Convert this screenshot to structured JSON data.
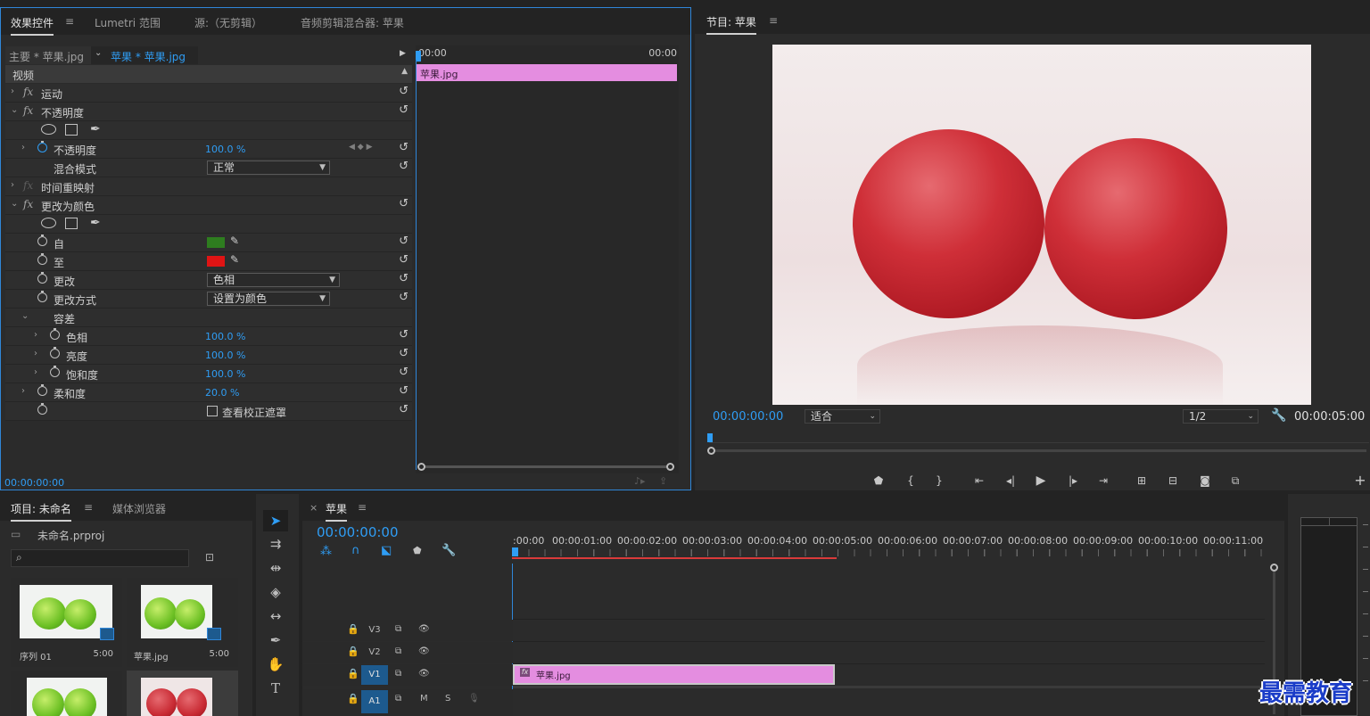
{
  "effects_panel": {
    "tabs": [
      "效果控件",
      "Lumetri 范围",
      "源:（无剪辑）",
      "音频剪辑混合器: 苹果"
    ],
    "menu_glyph": "≡",
    "master_clip": "主要 * 苹果.jpg",
    "sequence_clip": "苹果 * 苹果.jpg",
    "timeline_start": "00:00",
    "timeline_end": "00:00",
    "clip_name": "苹果.jpg",
    "section_video": "视频",
    "footer_time": "00:00:00:00",
    "effects": {
      "motion": "运动",
      "opacity": "不透明度",
      "opacity_param": "不透明度",
      "opacity_value": "100.0 %",
      "blend_mode_label": "混合模式",
      "blend_mode_value": "正常",
      "time_remap": "时间重映射",
      "change_to_color": "更改为颜色",
      "from_label": "自",
      "from_color": "#2e7d1f",
      "to_label": "至",
      "to_color": "#e01414",
      "change_label": "更改",
      "change_value": "色相",
      "change_by_label": "更改方式",
      "change_by_value": "设置为颜色",
      "tolerance_label": "容差",
      "hue_label": "色相",
      "hue_value": "100.0 %",
      "lightness_label": "亮度",
      "lightness_value": "100.0 %",
      "saturation_label": "饱和度",
      "saturation_value": "100.0 %",
      "softness_label": "柔和度",
      "softness_value": "20.0 %",
      "view_mask_label": "查看校正遮罩"
    }
  },
  "program_monitor": {
    "title": "节目: 苹果",
    "current_time": "00:00:00:00",
    "fit_value": "适合",
    "resolution_value": "1/2",
    "duration": "00:00:05:00",
    "bg_color": "#f0e4e5",
    "apple_color": "#c82a33"
  },
  "project_panel": {
    "tabs": [
      "项目: 未命名",
      "媒体浏览器"
    ],
    "project_file": "未命名.prproj",
    "search_placeholder": "",
    "items": [
      {
        "name": "序列 01",
        "duration": "5:00"
      },
      {
        "name": "苹果.jpg",
        "duration": "5:00"
      }
    ]
  },
  "timeline": {
    "close": "×",
    "sequence_name": "苹果",
    "current_time": "00:00:00:00",
    "ruler": [
      ":00:00",
      "00:00:01:00",
      "00:00:02:00",
      "00:00:03:00",
      "00:00:04:00",
      "00:00:05:00",
      "00:00:06:00",
      "00:00:07:00",
      "00:00:08:00",
      "00:00:09:00",
      "00:00:10:00",
      "00:00:11:00"
    ],
    "tracks": [
      "V3",
      "V2",
      "V1",
      "A1"
    ],
    "audio_m": "M",
    "audio_s": "S",
    "clip_name": "苹果.jpg",
    "clip_color": "#e48de0"
  },
  "watermark": "最需教育"
}
